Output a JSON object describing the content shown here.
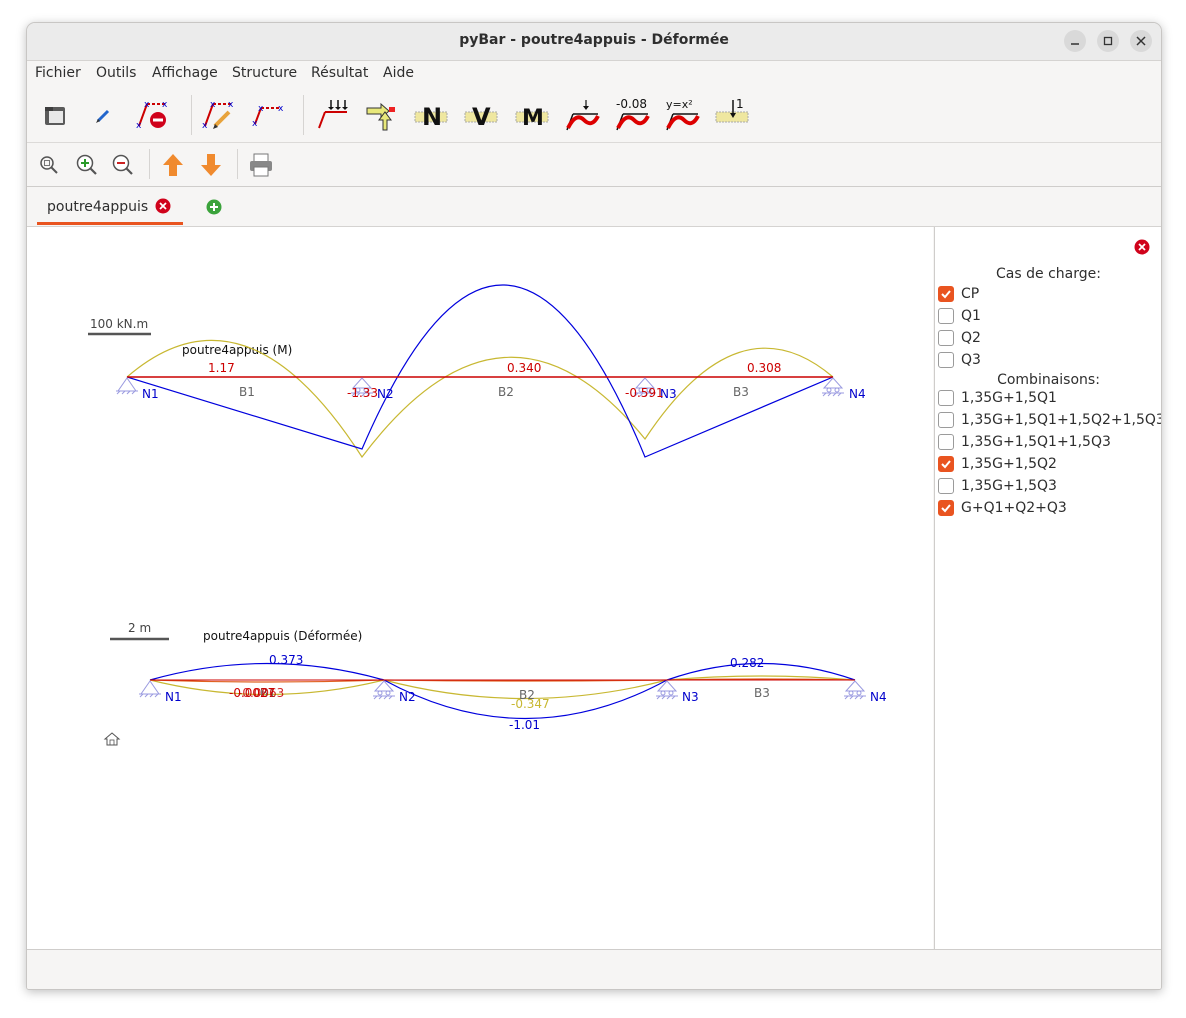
{
  "window": {
    "title": "pyBar - poutre4appuis - Déformée"
  },
  "menubar": {
    "items": [
      "Fichier",
      "Outils",
      "Affichage",
      "Structure",
      "Résultat",
      "Aide"
    ]
  },
  "toolbar": {
    "row1_icons": [
      "open-folder-icon",
      "edit-pencil-icon",
      "delete-bar-icon",
      "edit-structure-icon",
      "bar-icon",
      "distributed-load-icon",
      "node-load-icon",
      "normal-force-N-icon",
      "shear-force-V-icon",
      "moment-M-icon",
      "deformed-icon",
      "value-icon",
      "function-icon",
      "influence-line-icon"
    ],
    "value_label": "-0.08",
    "function_label": "y=x²",
    "influence_label": "1",
    "N_label": "N",
    "V_label": "V",
    "M_label": "M",
    "row2_icons": [
      "zoom-fit-icon",
      "zoom-in-icon",
      "zoom-out-icon",
      "arrow-up-icon",
      "arrow-down-icon",
      "print-icon"
    ]
  },
  "tabs": [
    {
      "label": "poutre4appuis"
    }
  ],
  "diagram_moment": {
    "scale_label": "100 kN.m",
    "title": "poutre4appuis (M)",
    "nodes": [
      "N1",
      "N2",
      "N3",
      "N4"
    ],
    "bars": [
      "B1",
      "B2",
      "B3"
    ],
    "red_values": [
      "1.17",
      "-1.33",
      "0.340",
      "-0.591",
      "0.308"
    ]
  },
  "diagram_deformed": {
    "scale_label": "2 m",
    "title": "poutre4appuis (Déformée)",
    "nodes": [
      "N1",
      "N2",
      "N3",
      "N4"
    ],
    "bars": [
      "B1",
      "B2",
      "B3"
    ],
    "blue_values": [
      "0.373",
      "-1.01",
      "0.282"
    ],
    "red_values": [
      "-0.0027",
      "-0.0063"
    ],
    "yellow_values": [
      "-0.347"
    ]
  },
  "sidepanel": {
    "cas_heading": "Cas de charge:",
    "cas": [
      {
        "label": "CP",
        "checked": true
      },
      {
        "label": "Q1",
        "checked": false
      },
      {
        "label": "Q2",
        "checked": false
      },
      {
        "label": "Q3",
        "checked": false
      }
    ],
    "comb_heading": "Combinaisons:",
    "combinaisons": [
      {
        "label": "1,35G+1,5Q1",
        "checked": false
      },
      {
        "label": "1,35G+1,5Q1+1,5Q2+1,5Q3",
        "checked": false
      },
      {
        "label": "1,35G+1,5Q1+1,5Q3",
        "checked": false
      },
      {
        "label": "1,35G+1,5Q2",
        "checked": true
      },
      {
        "label": "1,35G+1,5Q3",
        "checked": false
      },
      {
        "label": "G+Q1+Q2+Q3",
        "checked": true
      }
    ]
  },
  "colors": {
    "accent": "#e95420",
    "beam_red": "#cc0000",
    "curve_blue": "#0000dd",
    "curve_yellow": "#c8b832",
    "node_blue": "#0000cc"
  }
}
